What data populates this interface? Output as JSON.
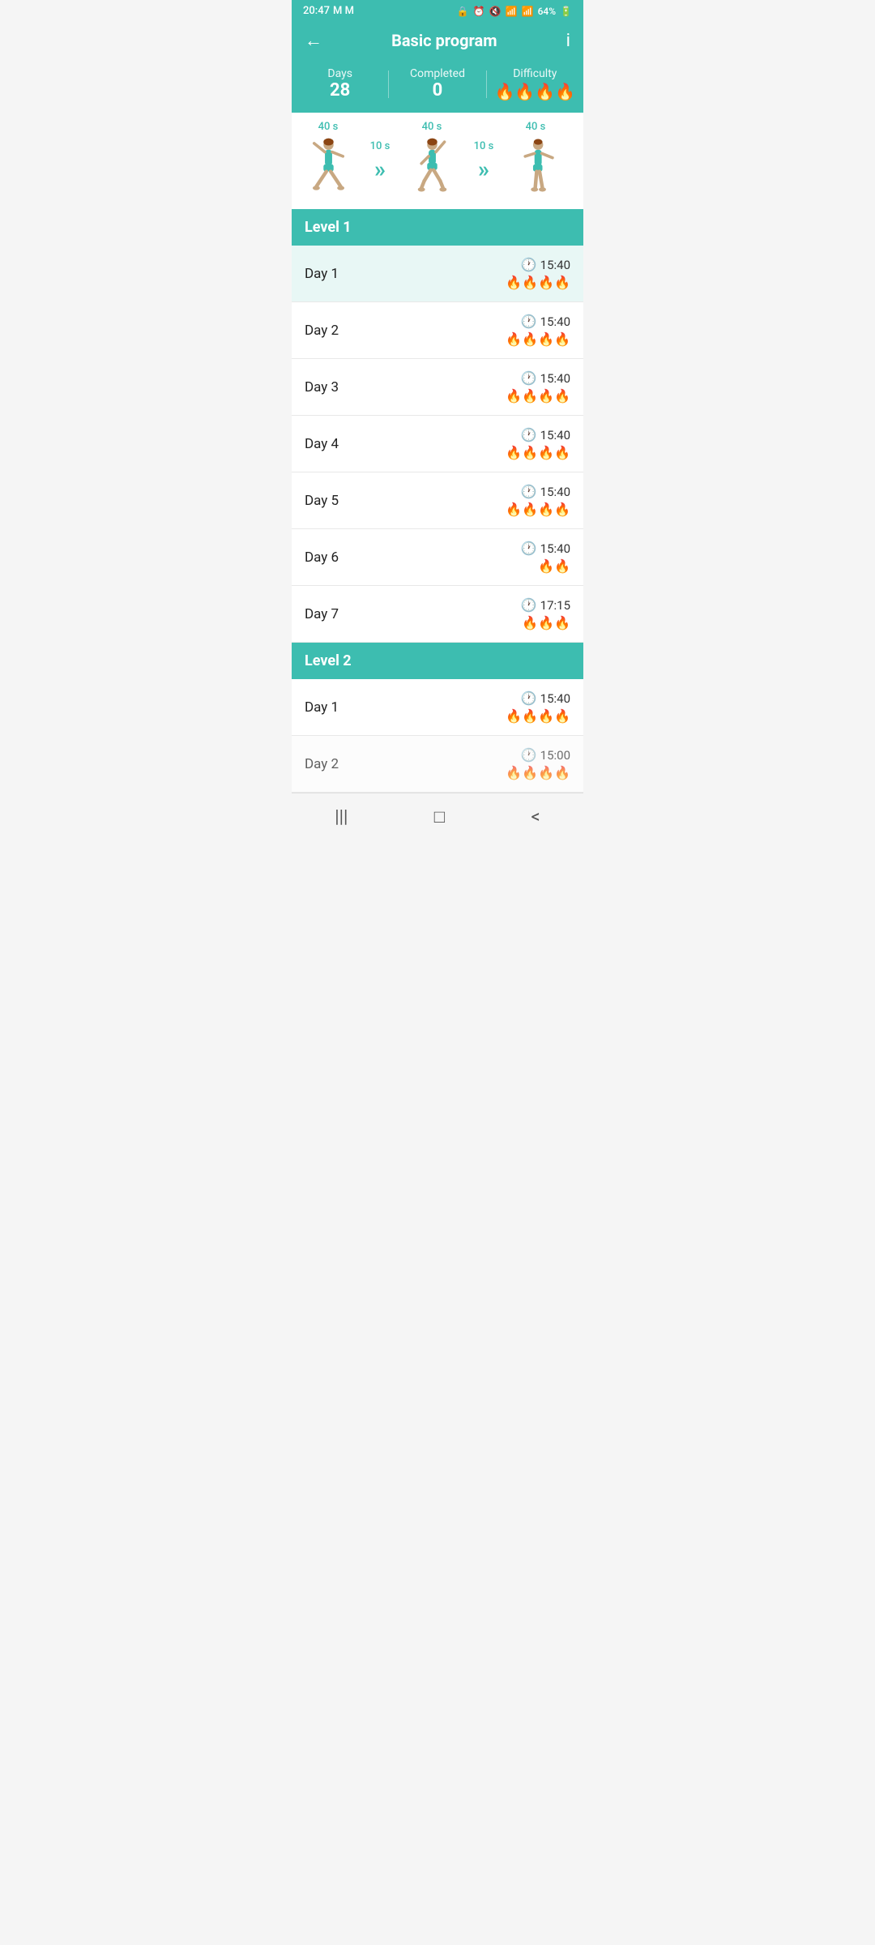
{
  "statusBar": {
    "time": "20:47",
    "carrier": "M M",
    "battery": "64%"
  },
  "header": {
    "title": "Basic program",
    "backLabel": "←",
    "infoLabel": "i"
  },
  "stats": {
    "daysLabel": "Days",
    "daysValue": "28",
    "completedLabel": "Completed",
    "completedValue": "0",
    "difficultyLabel": "Difficulty",
    "difficultyFires": "🔥🔥🔥🔥"
  },
  "exercises": [
    {
      "time": "40 s",
      "type": "figure",
      "id": "pose1"
    },
    {
      "time": "10 s",
      "type": "rest"
    },
    {
      "time": "40 s",
      "type": "figure",
      "id": "pose2"
    },
    {
      "time": "10 s",
      "type": "rest"
    },
    {
      "time": "40 s",
      "type": "figure",
      "id": "pose3"
    }
  ],
  "levels": [
    {
      "label": "Level 1",
      "days": [
        {
          "name": "Day 1",
          "duration": "15:40",
          "fires": "🔥🔥🔥🔥",
          "highlighted": true
        },
        {
          "name": "Day 2",
          "duration": "15:40",
          "fires": "🔥🔥🔥🔥",
          "highlighted": false
        },
        {
          "name": "Day 3",
          "duration": "15:40",
          "fires": "🔥🔥🔥🔥",
          "highlighted": false
        },
        {
          "name": "Day 4",
          "duration": "15:40",
          "fires": "🔥🔥🔥🔥",
          "highlighted": false
        },
        {
          "name": "Day 5",
          "duration": "15:40",
          "fires": "🔥🔥🔥🔥",
          "highlighted": false
        },
        {
          "name": "Day 6",
          "duration": "15:40",
          "fires": "🔥🔥",
          "highlighted": false
        },
        {
          "name": "Day 7",
          "duration": "17:15",
          "fires": "🔥🔥🔥",
          "highlighted": false
        }
      ]
    },
    {
      "label": "Level 2",
      "days": [
        {
          "name": "Day 1",
          "duration": "15:40",
          "fires": "🔥🔥🔥🔥",
          "highlighted": false
        },
        {
          "name": "Day 2",
          "duration": "15:00",
          "fires": "🔥🔥🔥🔥",
          "highlighted": false
        }
      ]
    }
  ],
  "navBar": {
    "menuIcon": "|||",
    "homeIcon": "□",
    "backIcon": "<"
  }
}
